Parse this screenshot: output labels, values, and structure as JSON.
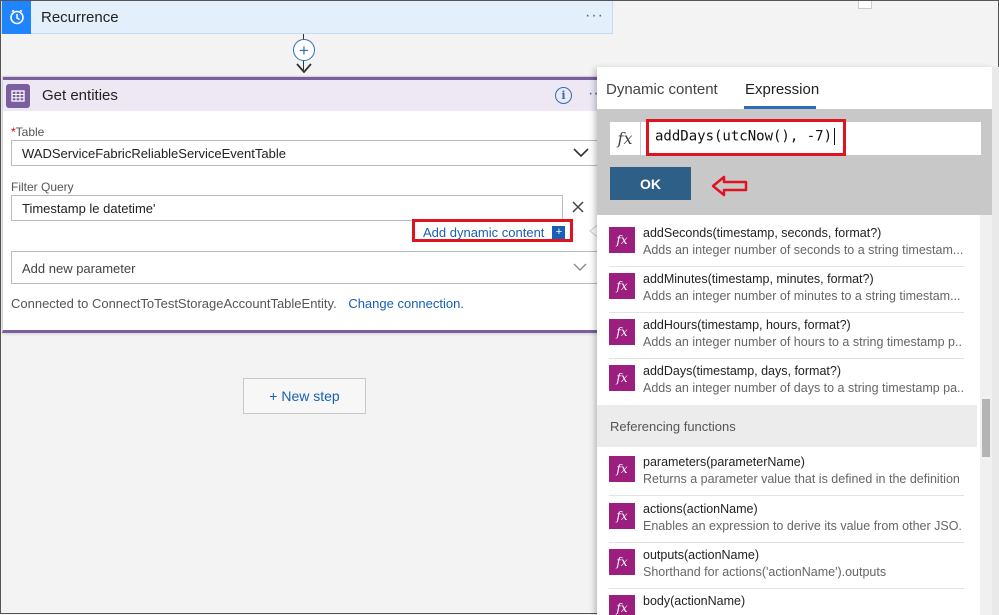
{
  "recurrence": {
    "title": "Recurrence",
    "more": "···"
  },
  "connector": {
    "plus": "+"
  },
  "get_entities": {
    "title": "Get entities",
    "info": "i",
    "more": "···",
    "table_label": "Table",
    "table_required": "*",
    "table_value": "WADServiceFabricReliableServiceEventTable",
    "filter_label": "Filter Query",
    "filter_value": "Timestamp le datetime'",
    "add_dynamic": "Add dynamic content",
    "add_dynamic_tag": "+",
    "add_param_placeholder": "Add new parameter",
    "connected_text": "Connected to ConnectToTestStorageAccountTableEntity.",
    "change_connection": "Change connection."
  },
  "new_step": "+ New step",
  "panel": {
    "tabs": [
      {
        "label": "Dynamic content",
        "active": false
      },
      {
        "label": "Expression",
        "active": true
      }
    ],
    "fx": "fx",
    "expression": "addDays(utcNow(), -7)",
    "ok": "OK",
    "functions": [
      {
        "name": "addSeconds(timestamp, seconds, format?)",
        "desc": "Adds an integer number of seconds to a string timestam..."
      },
      {
        "name": "addMinutes(timestamp, minutes, format?)",
        "desc": "Adds an integer number of minutes to a string timestam..."
      },
      {
        "name": "addHours(timestamp, hours, format?)",
        "desc": "Adds an integer number of hours to a string timestamp p..."
      },
      {
        "name": "addDays(timestamp, days, format?)",
        "desc": "Adds an integer number of days to a string timestamp pa..."
      }
    ],
    "section": "Referencing functions",
    "ref_functions": [
      {
        "name": "parameters(parameterName)",
        "desc": "Returns a parameter value that is defined in the definition"
      },
      {
        "name": "actions(actionName)",
        "desc": "Enables an expression to derive its value from other JSO..."
      },
      {
        "name": "outputs(actionName)",
        "desc": "Shorthand for actions('actionName').outputs"
      },
      {
        "name": "body(actionName)",
        "desc": ""
      }
    ]
  },
  "colors": {
    "accent_blue": "#1a5fb4",
    "highlight_red": "#e0141e",
    "function_icon": "#9c1f80",
    "ok_button": "#2e5f87",
    "entities_accent": "#7b5ea0"
  }
}
